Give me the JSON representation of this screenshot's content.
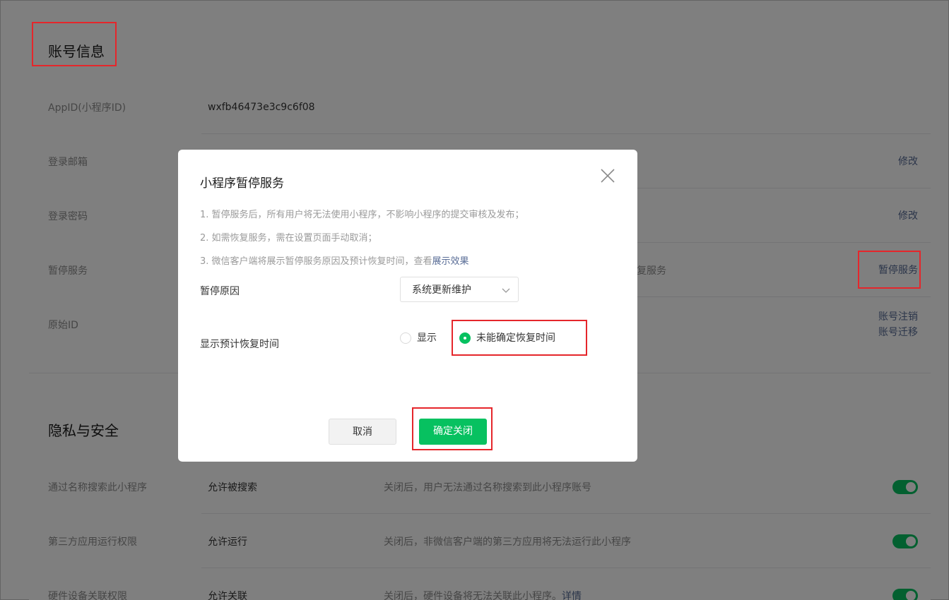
{
  "account_info": {
    "title": "账号信息",
    "rows": [
      {
        "label": "AppID(小程序ID)",
        "value": "wxfb46473e3c9c6f08",
        "action": ""
      },
      {
        "label": "登录邮箱",
        "value": "",
        "action": "修改"
      },
      {
        "label": "登录密码",
        "value": "",
        "action": "修改"
      },
      {
        "label": "暂停服务",
        "value": "",
        "desc_fragment": "复服务",
        "action": "暂停服务"
      },
      {
        "label": "原始ID",
        "value": "",
        "action": "账号注销",
        "action2": "账号迁移"
      }
    ]
  },
  "privacy": {
    "title": "隐私与安全",
    "rows": [
      {
        "label": "通过名称搜索此小程序",
        "value": "允许被搜索",
        "desc": "关闭后，用户无法通过名称搜索到此小程序账号",
        "enabled": true
      },
      {
        "label": "第三方应用运行权限",
        "value": "允许运行",
        "desc": "关闭后，非微信客户端的第三方应用将无法运行此小程序",
        "enabled": true
      },
      {
        "label": "硬件设备关联权限",
        "value": "允许关联",
        "desc": "关闭后，硬件设备将无法关联此小程序。",
        "desc_link": "详情",
        "enabled": true
      }
    ]
  },
  "dialog": {
    "title": "小程序暂停服务",
    "notes": [
      "1. 暂停服务后，所有用户将无法使用小程序，不影响小程序的提交审核及发布；",
      "2. 如需恢复服务，需在设置页面手动取消；",
      "3. 微信客户端将展示暂停服务原因及预计恢复时间，查看"
    ],
    "notes_link": "展示效果",
    "reason_label": "暂停原因",
    "reason_value": "系统更新维护",
    "recovery_label": "显示预计恢复时间",
    "radio_options": [
      {
        "label": "显示",
        "checked": false
      },
      {
        "label": "未能确定恢复时间",
        "checked": true
      }
    ],
    "cancel_label": "取消",
    "confirm_label": "确定关闭"
  },
  "colors": {
    "accent": "#07c160",
    "link": "#576b95",
    "highlight": "#e5262b"
  }
}
